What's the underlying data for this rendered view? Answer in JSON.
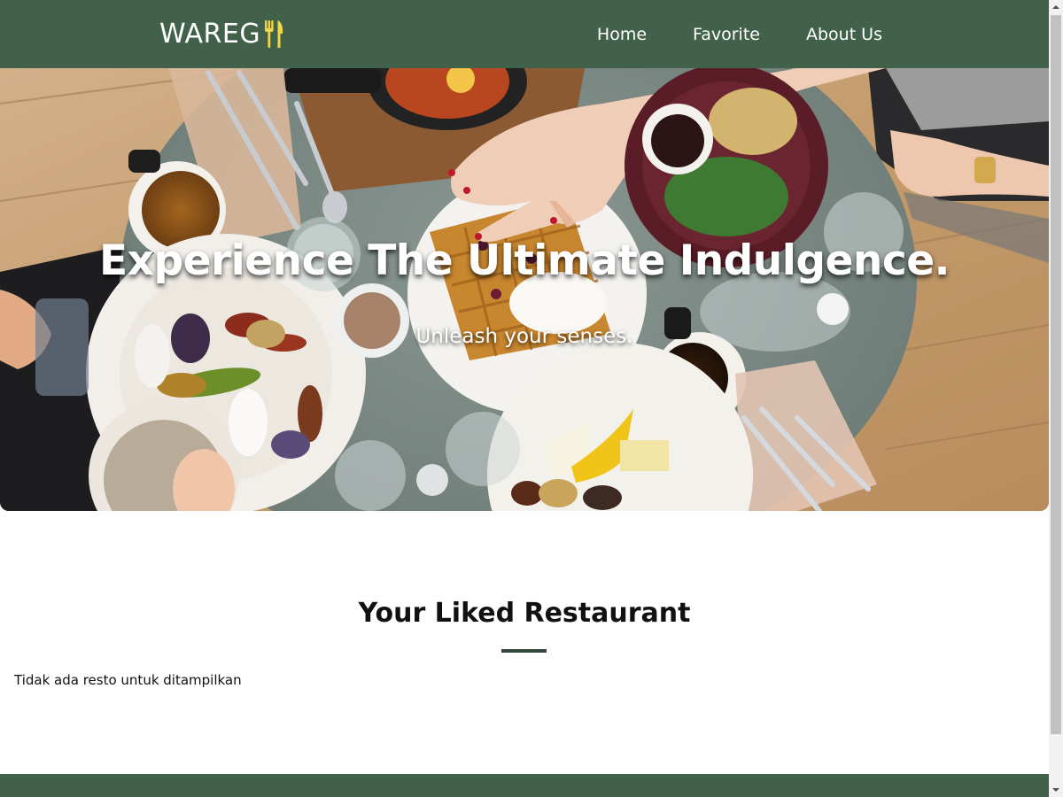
{
  "header": {
    "logo_text": "WAREG",
    "logo_icon": "fork-knife-icon",
    "nav": [
      {
        "label": "Home"
      },
      {
        "label": "Favorite"
      },
      {
        "label": "About Us"
      }
    ]
  },
  "hero": {
    "title": "Experience The Ultimate Indulgence.",
    "subtitle": "Unleash your senses."
  },
  "main": {
    "section_title": "Your Liked Restaurant",
    "empty_message": "Tidak ada resto untuk ditampilkan"
  },
  "colors": {
    "brand": "#42614a",
    "underline": "#33473a"
  }
}
